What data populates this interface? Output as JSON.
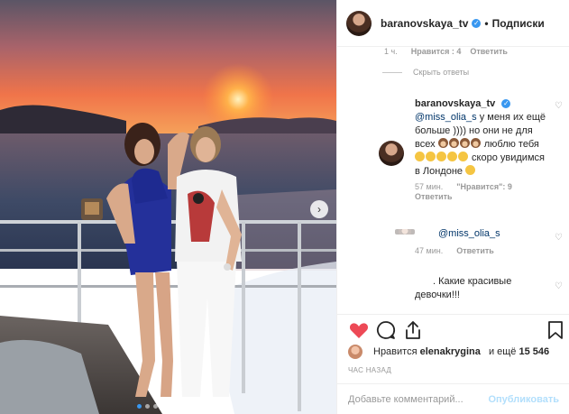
{
  "header": {
    "username": "baranovskaya_tv",
    "separator": "•",
    "follow_label": "Подписки"
  },
  "comments": {
    "prev_meta": {
      "time": "1 ч.",
      "likes": "Нравится : 4",
      "reply": "Ответить"
    },
    "hide_replies": "Скрыть ответы",
    "reply1": {
      "username": "baranovskaya_tv",
      "mention": "@miss_olia_s",
      "text_a": " у меня их ещё больше )))) но они не для всех",
      "text_b": " люблю тебя ",
      "text_c": " скоро увидимся в Лондоне ",
      "time": "57 мин.",
      "likes": "\"Нравится\": 9",
      "reply": "Ответить"
    },
    "reply2": {
      "mention": "@miss_olia_s",
      "time": "47 мин.",
      "reply": "Ответить"
    },
    "reply3": {
      "text": ". Какие красивые девочки!!!"
    }
  },
  "icons": {
    "heart": "heart-icon",
    "comment": "comment-icon",
    "share": "share-icon",
    "bookmark": "bookmark-icon",
    "verified": "verified-badge-icon"
  },
  "likes": {
    "prefix": "Нравится",
    "user": "elenakrygina",
    "middle": "и ещё",
    "count": "15 546"
  },
  "time_ago": "ЧАС НАЗАД",
  "composer": {
    "placeholder": "Добавьте комментарий...",
    "publish_label": "Опубликовать"
  },
  "colors": {
    "accent": "#3897f0",
    "like_red": "#ed4956",
    "publish_disabled": "#b2dffc"
  },
  "carousel": {
    "slides": 6,
    "current": 1
  }
}
